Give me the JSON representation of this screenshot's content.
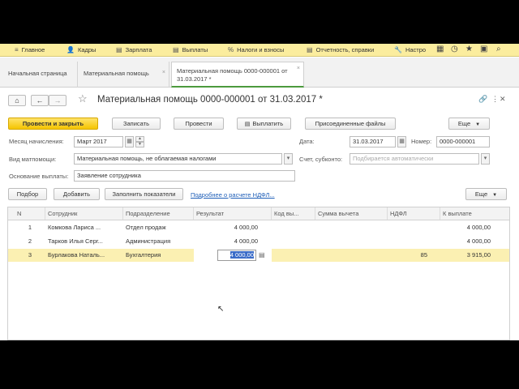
{
  "menu": {
    "items": [
      {
        "label": "Главное",
        "icon": "≡"
      },
      {
        "label": "Кадры",
        "icon": "👤"
      },
      {
        "label": "Зарплата",
        "icon": "▤"
      },
      {
        "label": "Выплаты",
        "icon": "▤"
      },
      {
        "label": "Налоги и взносы",
        "icon": "%"
      },
      {
        "label": "Отчетность, справки",
        "icon": "▤"
      },
      {
        "label": "Настро",
        "icon": "🔧"
      }
    ]
  },
  "tabs": [
    {
      "label": "Начальная страница"
    },
    {
      "label": "Материальная помощь"
    },
    {
      "label": "Материальная помощь 0000-000001 от 31.03.2017 *"
    }
  ],
  "document": {
    "title": "Материальная помощь 0000-000001 от 31.03.2017 *"
  },
  "toolbar": {
    "post_close": "Провести и закрыть",
    "save": "Записать",
    "post": "Провести",
    "pay": "Выплатить",
    "attached_files": "Присоединенные файлы",
    "more": "Еще"
  },
  "form": {
    "month_label": "Месяц начисления:",
    "month_value": "Март 2017",
    "date_label": "Дата:",
    "date_value": "31.03.2017",
    "number_label": "Номер:",
    "number_value": "0000-000001",
    "aid_type_label": "Вид матпомощи:",
    "aid_type_value": "Материальная помощь, не облагаемая налогами",
    "subconto_label": "Счет, субконто:",
    "subconto_placeholder": "Подбирается автоматически",
    "basis_label": "Основание выплаты:",
    "basis_value": "Заявление сотрудника"
  },
  "table_toolbar": {
    "select": "Подбор",
    "add": "Добавить",
    "fill": "Заполнить показатели",
    "ndfl_link": "Подробнее о расчете НДФЛ...",
    "more": "Еще"
  },
  "table": {
    "columns": [
      "N",
      "Сотрудник",
      "Подразделение",
      "Результат",
      "Код вы...",
      "Сумма вычета",
      "НДФЛ",
      "К выплате"
    ],
    "rows": [
      {
        "n": "1",
        "employee": "Комкова Лариса ...",
        "department": "Отдел продаж",
        "result": "4 000,00",
        "code": "",
        "deduction": "",
        "ndfl": "",
        "payout": "4 000,00"
      },
      {
        "n": "2",
        "employee": "Тарков Илья Серг...",
        "department": "Администрация",
        "result": "4 000,00",
        "code": "",
        "deduction": "",
        "ndfl": "",
        "payout": "4 000,00"
      },
      {
        "n": "3",
        "employee": "Бурлакова Наталь...",
        "department": "Бухгалтерия",
        "result": "4 000,00",
        "code": "",
        "deduction": "",
        "ndfl": "85",
        "payout": "3 915,00"
      }
    ]
  },
  "colors": {
    "primary_button": "#f5c400",
    "menubar": "#fbed9e",
    "selected_row": "#fbf0b2",
    "link": "#1f5fb8"
  }
}
